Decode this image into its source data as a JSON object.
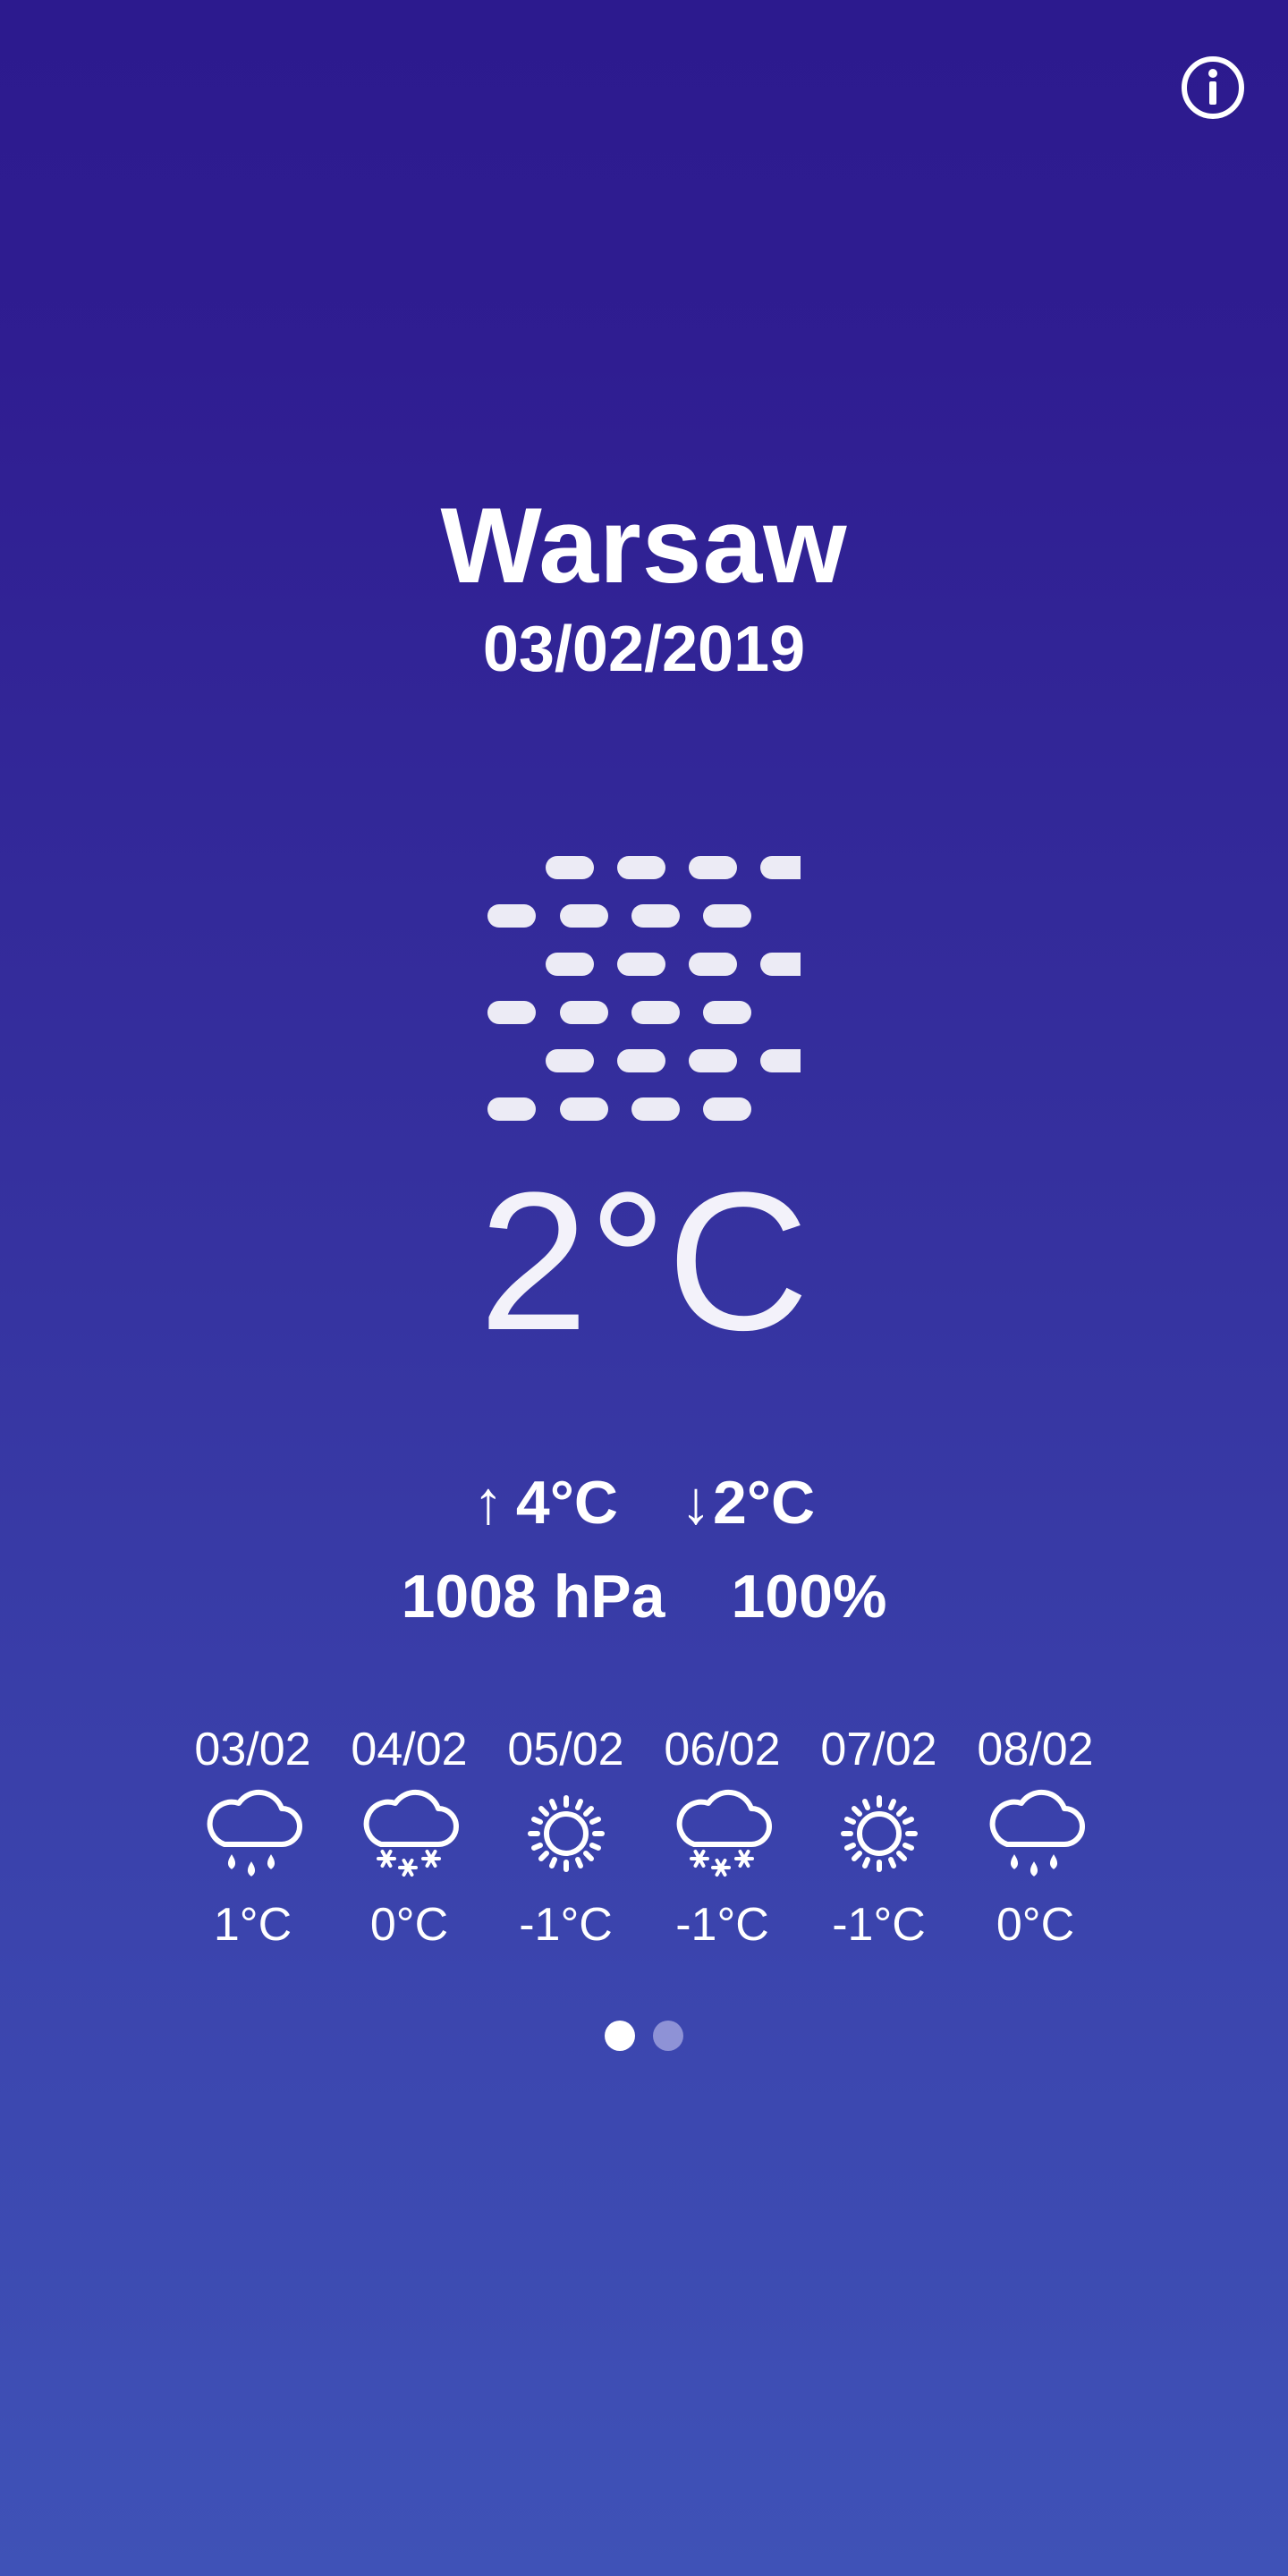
{
  "header": {
    "info_icon": "info-icon"
  },
  "location": {
    "city": "Warsaw",
    "date": "03/02/2019"
  },
  "current": {
    "icon": "fog-icon",
    "temperature": "2°C",
    "max_arrow": "↑",
    "max_temp": "4°C",
    "min_arrow": "↓",
    "min_temp": "2°C",
    "pressure": "1008 hPa",
    "humidity": "100%"
  },
  "forecast": [
    {
      "date": "03/02",
      "icon": "rain-icon",
      "temp": "1°C"
    },
    {
      "date": "04/02",
      "icon": "snow-icon",
      "temp": "0°C"
    },
    {
      "date": "05/02",
      "icon": "sun-icon",
      "temp": "-1°C"
    },
    {
      "date": "06/02",
      "icon": "snow-icon",
      "temp": "-1°C"
    },
    {
      "date": "07/02",
      "icon": "sun-icon",
      "temp": "-1°C"
    },
    {
      "date": "08/02",
      "icon": "rain-icon",
      "temp": "0°C"
    }
  ],
  "pager": {
    "pages": 2,
    "active_page": 1
  },
  "colors": {
    "background_top": "#2c1a8e",
    "background_bottom": "#3f52b7",
    "text": "#ffffff",
    "dot_active": "#ffffff",
    "dot_inactive": "#8e92d6"
  }
}
